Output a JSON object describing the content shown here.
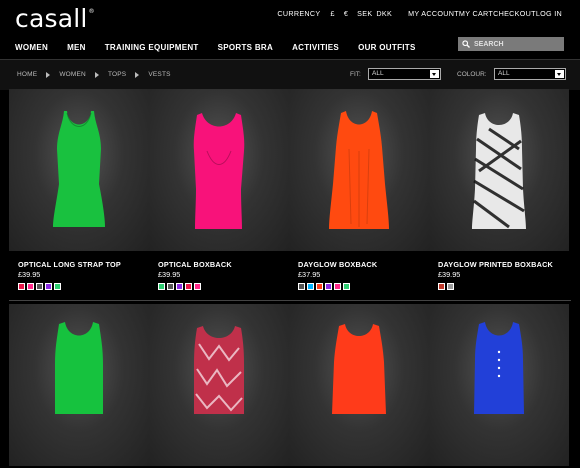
{
  "logo": "casall",
  "logo_mark": "®",
  "topnav": {
    "currency_label": "CURRENCY",
    "currencies": [
      "£",
      "€",
      "SEK",
      "DKK"
    ],
    "links": [
      "MY ACCOUNT",
      "MY CART",
      "CHECKOUT",
      "LOG IN"
    ]
  },
  "mainnav": [
    "WOMEN",
    "MEN",
    "TRAINING EQUIPMENT",
    "SPORTS BRA",
    "ACTIVITIES",
    "OUR OUTFITS"
  ],
  "search": {
    "label": "SEARCH"
  },
  "breadcrumb": [
    "HOME",
    "WOMEN",
    "TOPS",
    "VESTS"
  ],
  "filters": {
    "fit_label": "FIT:",
    "fit_value": "ALL",
    "colour_label": "COLOUR:",
    "colour_value": "ALL"
  },
  "products": [
    {
      "name": "OPTICAL LONG STRAP TOP",
      "price": "£39.95",
      "color": "#19c13f",
      "swatches": [
        "#e8184a",
        "#ff2a8a",
        "#555555",
        "#8a2be2",
        "#2ecc71"
      ]
    },
    {
      "name": "OPTICAL BOXBACK",
      "price": "£39.95",
      "color": "#f8127a",
      "swatches": [
        "#2ecc71",
        "#555555",
        "#8a2be2",
        "#e8184a",
        "#ff2a8a"
      ]
    },
    {
      "name": "DAYGLOW BOXBACK",
      "price": "£37.95",
      "color": "#ff4a10",
      "swatches": [
        "#555555",
        "#00b4ff",
        "#ff3b1a",
        "#8a2be2",
        "#ff2a8a",
        "#2ecc71"
      ]
    },
    {
      "name": "DAYGLOW PRINTED BOXBACK",
      "price": "£39.95",
      "color": "#e8e8e8",
      "swatches": [
        "#c0392b",
        "#9a9a9a"
      ]
    }
  ],
  "products_row2": [
    {
      "color": "#16c23e"
    },
    {
      "color": "#c0304a"
    },
    {
      "color": "#ff3b1a"
    },
    {
      "color": "#2240d8"
    }
  ]
}
